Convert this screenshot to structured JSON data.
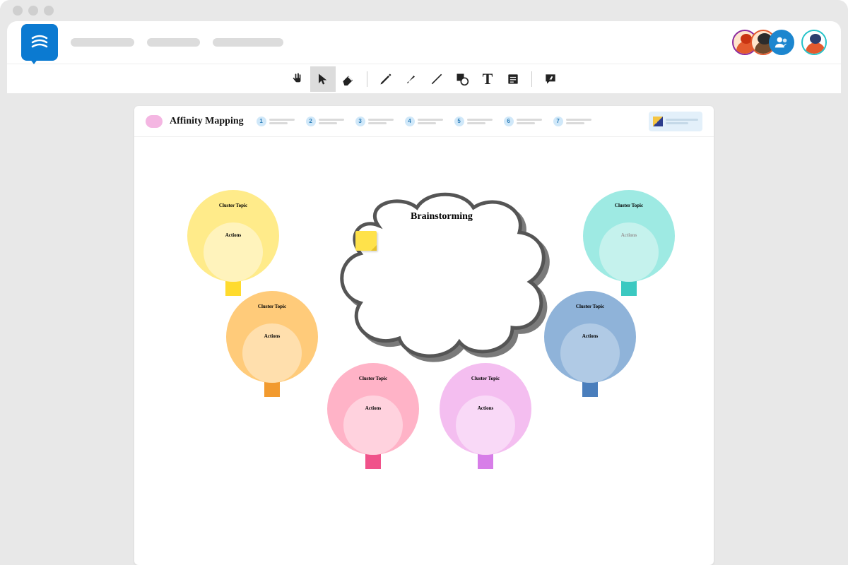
{
  "template": {
    "title": "Affinity Mapping",
    "steps": [
      1,
      2,
      3,
      4,
      5,
      6,
      7
    ]
  },
  "cloud": {
    "title": "Brainstorming"
  },
  "clusters": [
    {
      "label": "Cluster Topic",
      "action": "Actions",
      "color": "yellow"
    },
    {
      "label": "Cluster Topic",
      "action": "Actions",
      "color": "orange"
    },
    {
      "label": "Cluster Topic",
      "action": "Actions",
      "color": "pink"
    },
    {
      "label": "Cluster Topic",
      "action": "Actions",
      "color": "violet"
    },
    {
      "label": "Cluster Topic",
      "action": "Actions",
      "color": "blue"
    },
    {
      "label": "Cluster Topic",
      "action": "Actions",
      "color": "teal"
    }
  ],
  "tools": {
    "hand": "hand",
    "pointer": "pointer",
    "eraser": "eraser",
    "pencil": "pencil",
    "brush": "brush",
    "line": "line",
    "shape": "shape",
    "text": "text",
    "note": "note",
    "comment": "comment"
  }
}
